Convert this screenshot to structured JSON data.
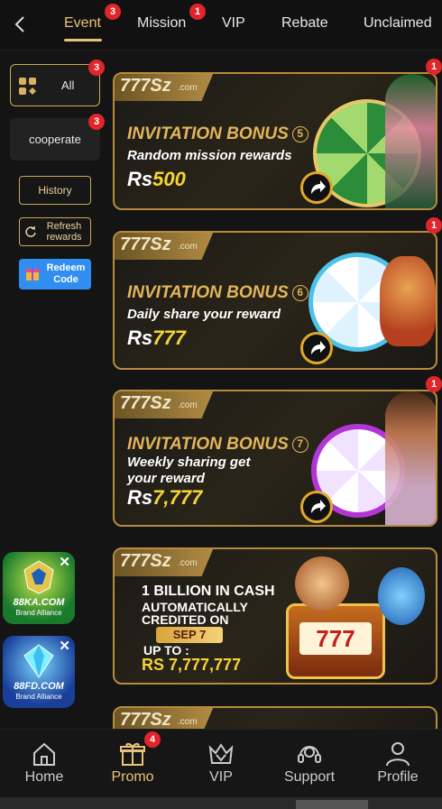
{
  "tabs": [
    {
      "label": "Event",
      "badge": "3",
      "active": true
    },
    {
      "label": "Mission",
      "badge": "1"
    },
    {
      "label": "VIP"
    },
    {
      "label": "Rebate"
    },
    {
      "label": "Unclaimed"
    }
  ],
  "sidebar": {
    "categories": [
      {
        "label": "All",
        "badge": "3"
      },
      {
        "label": "cooperate",
        "badge": "3"
      }
    ],
    "history": "History",
    "refresh": "Refresh rewards",
    "redeem": "Redeem Code"
  },
  "banners": [
    {
      "logo": "777Sz",
      "logo_domain": ".com",
      "title": "INVITATION BONUS",
      "num": "5",
      "subtitle": "Random mission rewards",
      "currency": "Rs",
      "amount": "500",
      "badge": "1"
    },
    {
      "logo": "777Sz",
      "logo_domain": ".com",
      "title": "INVITATION BONUS",
      "num": "6",
      "subtitle": "Daily share your reward",
      "currency": "Rs",
      "amount": "777",
      "badge": "1"
    },
    {
      "logo": "777Sz",
      "logo_domain": ".com",
      "title": "INVITATION BONUS",
      "num": "7",
      "subtitle_line1": "Weekly sharing get",
      "subtitle_line2": "your reward",
      "currency": "Rs",
      "amount": "7,777",
      "badge": "1"
    },
    {
      "logo": "777Sz",
      "logo_domain": ".com",
      "line1": "1 BILLION IN CASH",
      "line2": "AUTOMATICALLY",
      "line3": "CREDITED ON",
      "date": "SEP 7",
      "line4": "UP TO :",
      "amount": "RS 7,777,777"
    },
    {
      "logo": "777Sz",
      "logo_domain": ".com"
    }
  ],
  "ads": [
    {
      "name": "88KA.COM",
      "sub": "Brand Alliance"
    },
    {
      "name": "88FD.COM",
      "sub": "Brand Alliance"
    }
  ],
  "nav": [
    {
      "label": "Home",
      "icon": "home-icon"
    },
    {
      "label": "Promo",
      "icon": "gift-icon",
      "badge": "4",
      "active": true
    },
    {
      "label": "VIP",
      "icon": "crown-icon"
    },
    {
      "label": "Support",
      "icon": "headset-icon"
    },
    {
      "label": "Profile",
      "icon": "person-icon"
    }
  ],
  "colors": {
    "accent": "#e9c27a",
    "badge": "#e0252b",
    "gold": "#e4b55a",
    "amount": "#f6d435"
  }
}
